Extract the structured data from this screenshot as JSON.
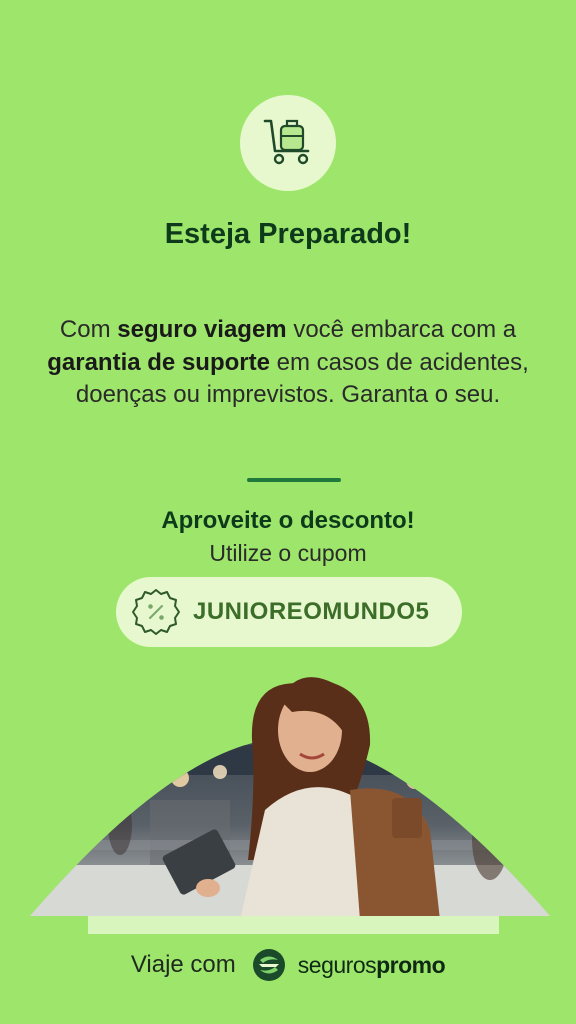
{
  "header": {
    "icon": "cart-luggage-icon",
    "title": "Esteja Preparado!"
  },
  "message": {
    "part1": "Com ",
    "bold1": "seguro viagem",
    "part2": " você embarca com a ",
    "bold2": "garantia de suporte",
    "part3": " em casos de acidentes, doenças ou imprevistos. Garanta o seu."
  },
  "promo": {
    "headline": "Aproveite o desconto!",
    "subline": "Utilize o cupom",
    "coupon_icon": "percent-badge-icon",
    "coupon_code": "JUNIOREOMUNDO5"
  },
  "footer": {
    "prefix": "Viaje com",
    "brand_part1": "seguros",
    "brand_part2": "promo",
    "logo_icon": "segurospromo-logo-icon"
  },
  "colors": {
    "background": "#9ee66b",
    "pale": "#e7f8cf",
    "dark_green": "#0e3a1c",
    "accent_green": "#1e7a3a"
  }
}
